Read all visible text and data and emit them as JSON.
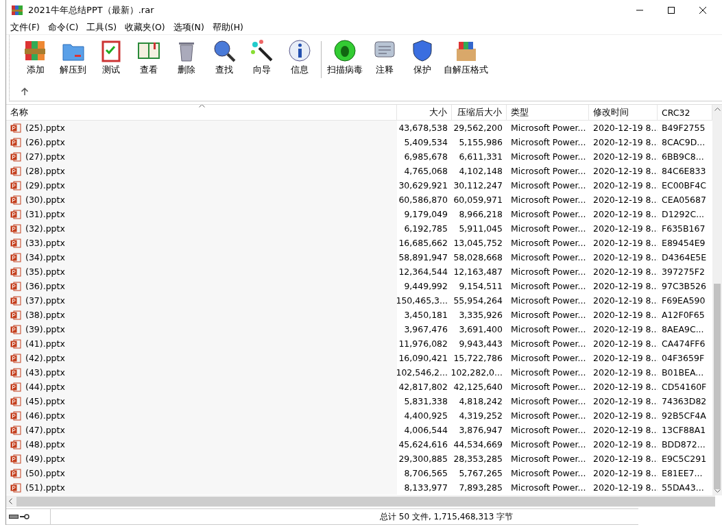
{
  "window": {
    "title": "2021牛年总结PPT（最新）.rar"
  },
  "menu": [
    "文件(F)",
    "命令(C)",
    "工具(S)",
    "收藏夹(O)",
    "选项(N)",
    "帮助(H)"
  ],
  "toolbar_groups": [
    [
      "添加",
      "解压到",
      "测试",
      "查看",
      "删除",
      "查找",
      "向导",
      "信息"
    ],
    [
      "扫描病毒",
      "注释",
      "保护",
      "自解压格式"
    ]
  ],
  "table": {
    "columns": [
      {
        "label": "名称",
        "sorted": true
      },
      {
        "label": "大小",
        "sorted": false
      },
      {
        "label": "压缩后大小",
        "sorted": false
      },
      {
        "label": "类型",
        "sorted": false
      },
      {
        "label": "修改时间",
        "sorted": false
      },
      {
        "label": "CRC32",
        "sorted": false
      }
    ],
    "rows": [
      [
        "(25).pptx",
        "43,678,538",
        "29,562,200",
        "Microsoft Power...",
        "2020-12-19 8...",
        "B49F2755"
      ],
      [
        "(26).pptx",
        "5,409,534",
        "5,155,986",
        "Microsoft Power...",
        "2020-12-19 8...",
        "8CAC9D..."
      ],
      [
        "(27).pptx",
        "6,985,678",
        "6,611,331",
        "Microsoft Power...",
        "2020-12-19 8...",
        "6BB9C8..."
      ],
      [
        "(28).pptx",
        "4,765,068",
        "4,102,148",
        "Microsoft Power...",
        "2020-12-19 8...",
        "84C6E833"
      ],
      [
        "(29).pptx",
        "30,629,921",
        "30,112,247",
        "Microsoft Power...",
        "2020-12-19 8...",
        "EC00BF4C"
      ],
      [
        "(30).pptx",
        "60,586,870",
        "60,059,971",
        "Microsoft Power...",
        "2020-12-19 8...",
        "CEA05687"
      ],
      [
        "(31).pptx",
        "9,179,049",
        "8,966,218",
        "Microsoft Power...",
        "2020-12-19 8...",
        "D1292C..."
      ],
      [
        "(32).pptx",
        "6,192,785",
        "5,911,045",
        "Microsoft Power...",
        "2020-12-19 8...",
        "F635B167"
      ],
      [
        "(33).pptx",
        "16,685,662",
        "13,045,752",
        "Microsoft Power...",
        "2020-12-19 8...",
        "E89454E9"
      ],
      [
        "(34).pptx",
        "58,891,947",
        "58,028,668",
        "Microsoft Power...",
        "2020-12-19 8...",
        "D4364E5E"
      ],
      [
        "(35).pptx",
        "12,364,544",
        "12,163,487",
        "Microsoft Power...",
        "2020-12-19 8...",
        "397275F2"
      ],
      [
        "(36).pptx",
        "9,449,992",
        "9,154,511",
        "Microsoft Power...",
        "2020-12-19 8...",
        "97C3B526"
      ],
      [
        "(37).pptx",
        "150,465,3...",
        "55,954,264",
        "Microsoft Power...",
        "2020-12-19 8...",
        "F69EA590"
      ],
      [
        "(38).pptx",
        "3,450,181",
        "3,335,926",
        "Microsoft Power...",
        "2020-12-19 8...",
        "A12F0F65"
      ],
      [
        "(39).pptx",
        "3,967,476",
        "3,691,400",
        "Microsoft Power...",
        "2020-12-19 8...",
        "8AEA9C..."
      ],
      [
        "(41).pptx",
        "11,976,082",
        "9,943,443",
        "Microsoft Power...",
        "2020-12-19 8...",
        "CA474FF6"
      ],
      [
        "(42).pptx",
        "16,090,421",
        "15,722,786",
        "Microsoft Power...",
        "2020-12-19 8...",
        "04F3659F"
      ],
      [
        "(43).pptx",
        "102,546,2...",
        "102,282,0...",
        "Microsoft Power...",
        "2020-12-19 8...",
        "B01BEA..."
      ],
      [
        "(44).pptx",
        "42,817,802",
        "42,125,640",
        "Microsoft Power...",
        "2020-12-19 8...",
        "CD54160F"
      ],
      [
        "(45).pptx",
        "5,831,338",
        "4,818,242",
        "Microsoft Power...",
        "2020-12-19 8...",
        "74363D82"
      ],
      [
        "(46).pptx",
        "4,400,925",
        "4,319,252",
        "Microsoft Power...",
        "2020-12-19 8...",
        "92B5CF4A"
      ],
      [
        "(47).pptx",
        "4,006,544",
        "3,876,947",
        "Microsoft Power...",
        "2020-12-19 8...",
        "13CF88A1"
      ],
      [
        "(48).pptx",
        "45,624,616",
        "44,534,669",
        "Microsoft Power...",
        "2020-12-19 8...",
        "BDD872..."
      ],
      [
        "(49).pptx",
        "29,300,885",
        "28,353,285",
        "Microsoft Power...",
        "2020-12-19 8...",
        "E9C5C291"
      ],
      [
        "(50).pptx",
        "8,706,565",
        "5,767,265",
        "Microsoft Power...",
        "2020-12-19 8...",
        "E81EE7..."
      ],
      [
        "(51).pptx",
        "8,133,977",
        "7,893,285",
        "Microsoft Power...",
        "2020-12-19 8...",
        "55DA43..."
      ]
    ]
  },
  "status_bar": {
    "text": "总计 50 文件, 1,715,468,313 字节"
  }
}
